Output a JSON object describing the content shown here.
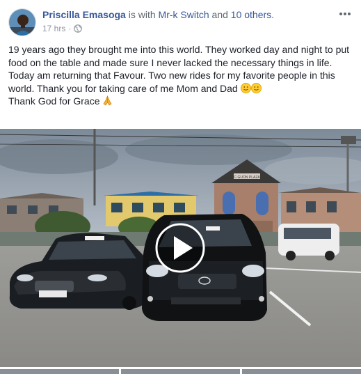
{
  "post": {
    "author": "Priscilla Emasoga",
    "with_text": " is with ",
    "tagged_person": "Mr-k Switch",
    "and_text": " and ",
    "others": "10 others",
    "period": ".",
    "timestamp": "17 hrs",
    "separator": "·",
    "privacy_icon": "globe-icon",
    "menu_icon": "more-options-icon",
    "body_line1": "19 years ago they brought me into this world. They worked day and night to put food on the table and made sure I never lacked the necessary things in life.",
    "body_line2": "Today am returning that Favour. Two new rides for my favorite people in this world. Thank you for taking care of me Mom and Dad",
    "body_line3": "Thank God for Grace",
    "emoji_1": "slightly-smiling-face",
    "emoji_2": "slightly-smiling-face",
    "emoji_3": "folded-hands"
  },
  "media": {
    "type": "video",
    "play_icon": "play-icon",
    "building_sign": "C·GUON PLAZA"
  },
  "colors": {
    "author": "#385898",
    "meta": "#90949c",
    "text": "#1d2129"
  }
}
